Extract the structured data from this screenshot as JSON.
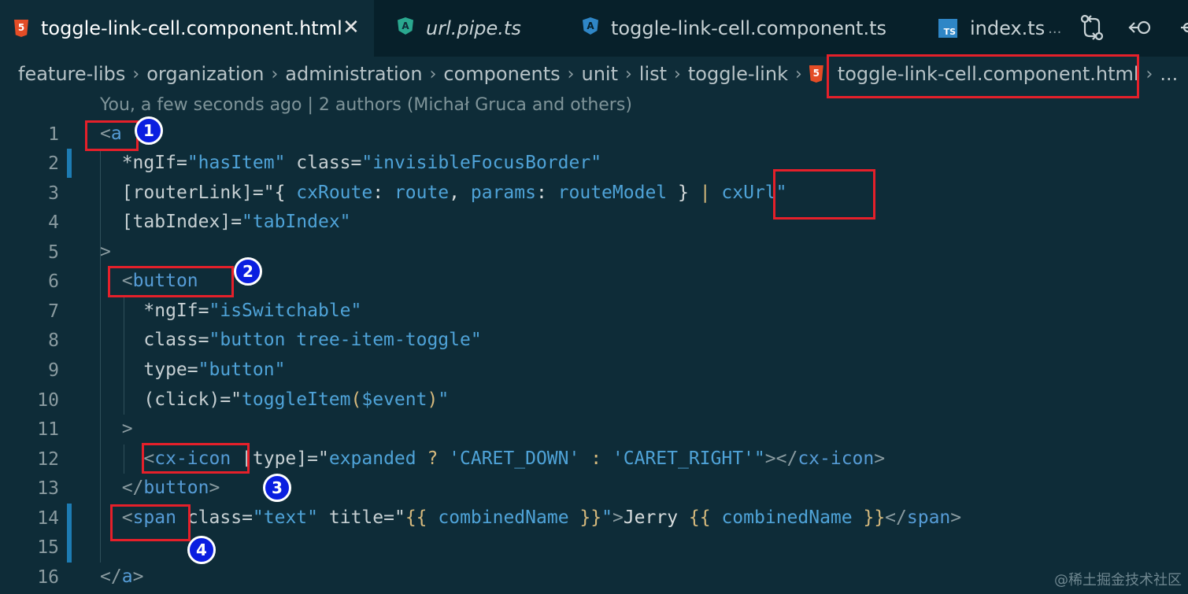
{
  "tabs": [
    {
      "label": "toggle-link-cell.component.html",
      "icon": "html5-icon",
      "active": true
    },
    {
      "label": "url.pipe.ts",
      "icon": "angular-icon",
      "italic": true
    },
    {
      "label": "toggle-link-cell.component.ts",
      "icon": "angular-icon"
    },
    {
      "label": "index.ts",
      "icon": "typescript-icon",
      "suffix": "..."
    }
  ],
  "tab_icons": {
    "ts_label": "TS"
  },
  "breadcrumb": [
    "feature-libs",
    "organization",
    "administration",
    "components",
    "unit",
    "list",
    "toggle-link"
  ],
  "breadcrumb_current": "toggle-link-cell.component.html",
  "breadcrumb_more": "...",
  "blame": "You, a few seconds ago | 2 authors (Michał Gruca and others)",
  "line_numbers": [
    "1",
    "2",
    "3",
    "4",
    "5",
    "6",
    "7",
    "8",
    "9",
    "10",
    "11",
    "12",
    "13",
    "14",
    "15",
    "16"
  ],
  "code": {
    "l1": {
      "open": "<",
      "tag": "a"
    },
    "l2": {
      "attr1": "*ngIf",
      "eq": "=",
      "val1": "\"hasItem\"",
      "attr2": "class",
      "val2": "\"invisibleFocusBorder\""
    },
    "l3": {
      "attr": "[routerLink]",
      "eq": "=\"",
      "b1": "{ ",
      "k1": "cxRoute",
      "c1": ": ",
      "v1": "route",
      "comma": ", ",
      "k2": "params",
      "c2": ": ",
      "v2": "routeModel",
      "b2": " }",
      "pipe": " | ",
      "fn": "cxUrl",
      "q": "\""
    },
    "l4": {
      "attr": "[tabIndex]",
      "eq": "=",
      "val": "\"tabIndex\""
    },
    "l5": {
      "close": ">"
    },
    "l6": {
      "open": "<",
      "tag": "button"
    },
    "l7": {
      "attr": "*ngIf",
      "eq": "=",
      "val": "\"isSwitchable\""
    },
    "l8": {
      "attr": "class",
      "eq": "=",
      "val": "\"button tree-item-toggle\""
    },
    "l9": {
      "attr": "type",
      "eq": "=",
      "val": "\"button\""
    },
    "l10": {
      "attr": "(click)",
      "eq": "=\"",
      "fn": "toggleItem",
      "p1": "(",
      "arg": "$event",
      "p2": ")",
      "q": "\""
    },
    "l11": {
      "close": ">"
    },
    "l12": {
      "open": "<",
      "tag": "cx-icon",
      "attr": "[type]",
      "eq": "=\"",
      "v": "expanded",
      "q1": " ? ",
      "s1": "'CARET_DOWN'",
      "col": " : ",
      "s2": "'CARET_RIGHT'",
      "q": "\"",
      "gt": "></",
      "ctag": "cx-icon",
      "end": ">"
    },
    "l13": {
      "open": "</",
      "tag": "button",
      "close": ">"
    },
    "l14": {
      "open": "<",
      "tag": "span",
      "attr1": "class",
      "eq": "=",
      "val1": "\"text\"",
      "attr2": "title",
      "eq2": "=\"",
      "b1": "{{ ",
      "v1": "combinedName",
      "b2": " }}",
      "q": "\"",
      "gt": ">",
      "txt": "Jerry ",
      "b3": "{{ ",
      "v2": "combinedName",
      "b4": " }}",
      "ctag1": "</",
      "ctag": "span",
      "end": ">"
    },
    "l16": {
      "open": "</",
      "tag": "a",
      "close": ">"
    }
  },
  "badges": [
    "1",
    "2",
    "3",
    "4"
  ],
  "watermark": "@稀土掘金技术社区",
  "colors": {
    "background": "#0e2c38",
    "tab_bar": "#07202a",
    "highlight_box": "#e5202a",
    "badge": "#0a1ee0",
    "tag": "#569cd6",
    "string": "#4fa3d8"
  }
}
